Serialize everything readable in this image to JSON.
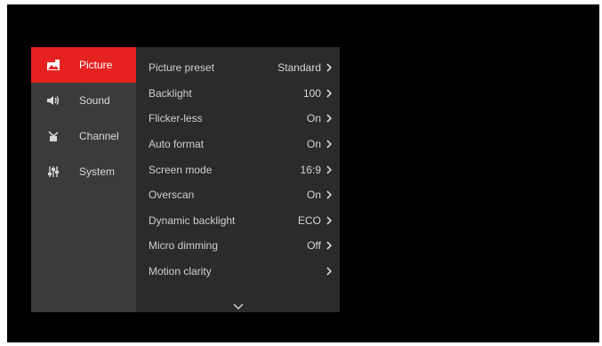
{
  "sidebar": {
    "items": [
      {
        "label": "Picture",
        "icon": "picture-icon",
        "active": true
      },
      {
        "label": "Sound",
        "icon": "speaker-icon",
        "active": false
      },
      {
        "label": "Channel",
        "icon": "antenna-icon",
        "active": false
      },
      {
        "label": "System",
        "icon": "sliders-icon",
        "active": false
      }
    ]
  },
  "picture_menu": {
    "rows": [
      {
        "label": "Picture preset",
        "value": "Standard"
      },
      {
        "label": "Backlight",
        "value": "100"
      },
      {
        "label": "Flicker-less",
        "value": "On"
      },
      {
        "label": "Auto format",
        "value": "On"
      },
      {
        "label": "Screen mode",
        "value": "16:9"
      },
      {
        "label": "Overscan",
        "value": "On"
      },
      {
        "label": "Dynamic backlight",
        "value": "ECO"
      },
      {
        "label": "Micro dimming",
        "value": "Off"
      },
      {
        "label": "Motion clarity",
        "value": ""
      }
    ],
    "more_indicator": "chevron-down-icon"
  },
  "colors": {
    "accent": "#e5221f",
    "sidebar_bg": "#3b3b3b",
    "content_bg": "#2b2b2b",
    "screen_bg": "#000000"
  }
}
